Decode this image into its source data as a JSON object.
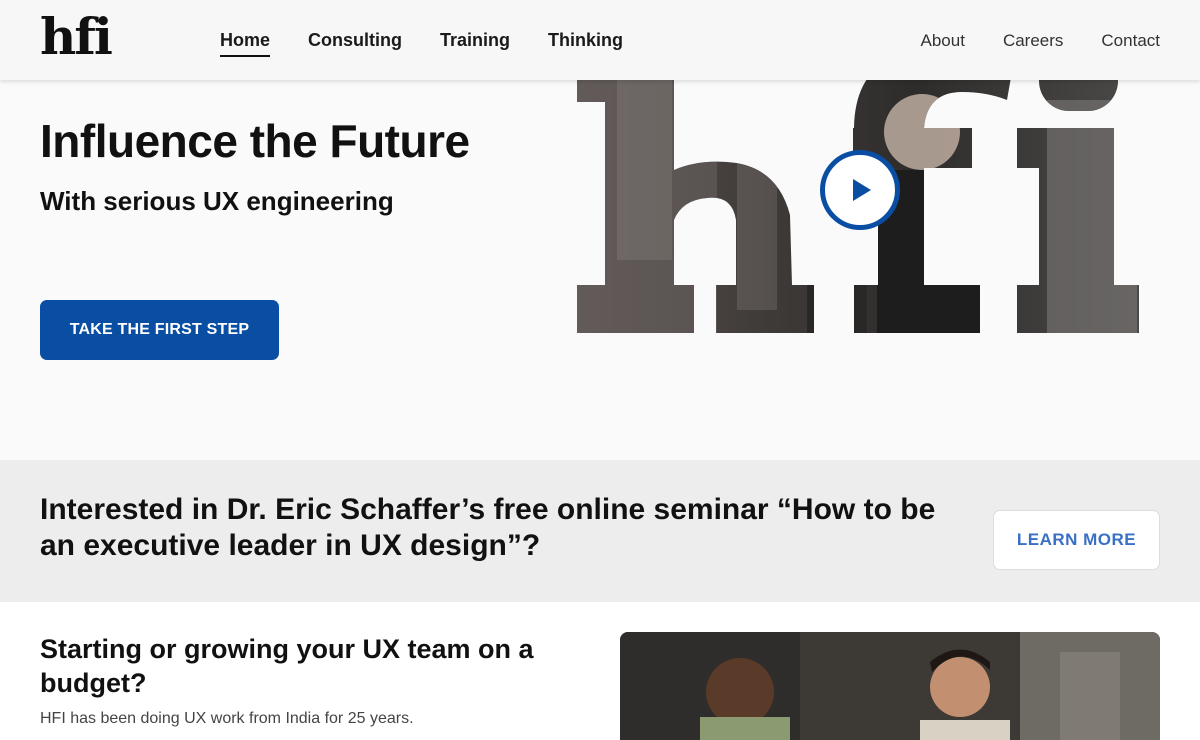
{
  "header": {
    "logo": "hfi",
    "nav_main": [
      {
        "label": "Home",
        "active": true
      },
      {
        "label": "Consulting"
      },
      {
        "label": "Training"
      },
      {
        "label": "Thinking"
      }
    ],
    "nav_right": [
      {
        "label": "About"
      },
      {
        "label": "Careers"
      },
      {
        "label": "Contact"
      }
    ]
  },
  "hero": {
    "title": "Influence the Future",
    "subtitle": "With serious UX engineering",
    "cta_label": "TAKE THE FIRST STEP",
    "video_icon": "play-icon"
  },
  "seminar": {
    "text": "Interested in Dr. Eric Schaffer’s free online seminar “How to be an executive leader in UX design”?",
    "button_label": "LEARN MORE"
  },
  "lower": {
    "title": "Starting or growing your UX team on a budget?",
    "text": "HFI has been doing UX work from India for 25 years."
  },
  "colors": {
    "brand_blue": "#0a4ea3",
    "learn_more_text": "#3a6fc7",
    "band_bg": "#ededed"
  }
}
